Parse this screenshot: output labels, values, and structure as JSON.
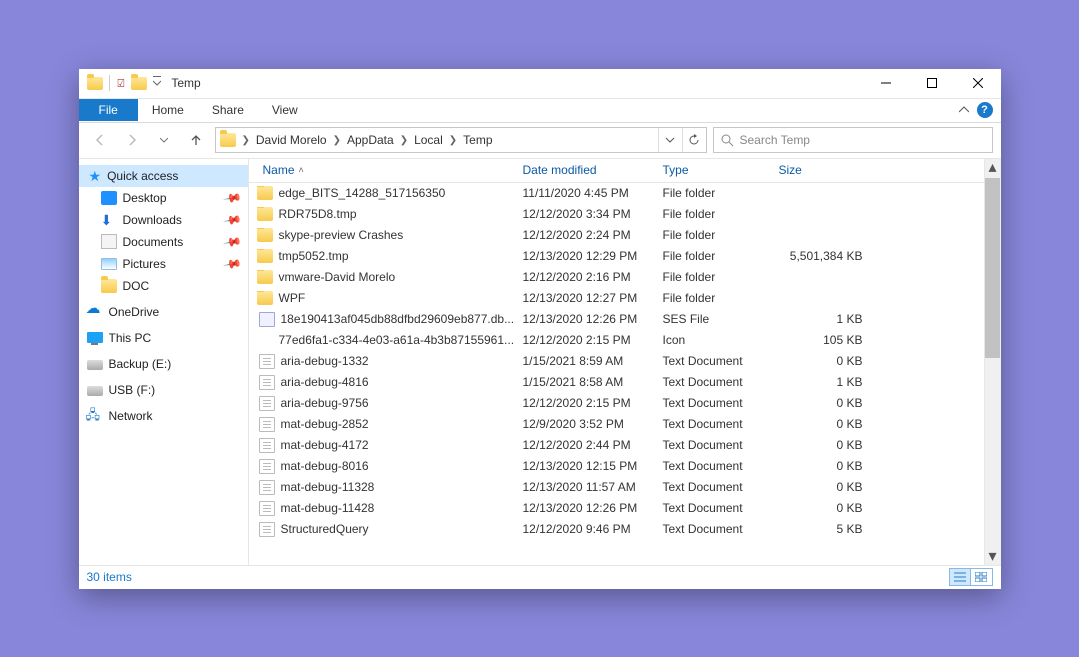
{
  "window": {
    "title": "Temp"
  },
  "ribbon": {
    "file": "File",
    "home": "Home",
    "share": "Share",
    "view": "View"
  },
  "breadcrumb": [
    "David Morelo",
    "AppData",
    "Local",
    "Temp"
  ],
  "search": {
    "placeholder": "Search Temp"
  },
  "sidebar": {
    "quick_access": "Quick access",
    "pinned": [
      {
        "label": "Desktop",
        "icon": "desktop"
      },
      {
        "label": "Downloads",
        "icon": "downloads"
      },
      {
        "label": "Documents",
        "icon": "documents"
      },
      {
        "label": "Pictures",
        "icon": "pictures"
      }
    ],
    "doc": "DOC",
    "roots": [
      {
        "label": "OneDrive",
        "icon": "onedrive"
      },
      {
        "label": "This PC",
        "icon": "thispc"
      },
      {
        "label": "Backup (E:)",
        "icon": "drive"
      },
      {
        "label": "USB (F:)",
        "icon": "usb"
      },
      {
        "label": "Network",
        "icon": "network"
      }
    ]
  },
  "columns": {
    "name": "Name",
    "date": "Date modified",
    "type": "Type",
    "size": "Size"
  },
  "rows": [
    {
      "icon": "folder",
      "name": "edge_BITS_14288_517156350",
      "date": "11/11/2020 4:45 PM",
      "type": "File folder",
      "size": ""
    },
    {
      "icon": "folder",
      "name": "RDR75D8.tmp",
      "date": "12/12/2020 3:34 PM",
      "type": "File folder",
      "size": ""
    },
    {
      "icon": "folder",
      "name": "skype-preview Crashes",
      "date": "12/12/2020 2:24 PM",
      "type": "File folder",
      "size": ""
    },
    {
      "icon": "folder",
      "name": "tmp5052.tmp",
      "date": "12/13/2020 12:29 PM",
      "type": "File folder",
      "size": "5,501,384 KB"
    },
    {
      "icon": "folder",
      "name": "vmware-David Morelo",
      "date": "12/12/2020 2:16 PM",
      "type": "File folder",
      "size": ""
    },
    {
      "icon": "folder",
      "name": "WPF",
      "date": "12/13/2020 12:27 PM",
      "type": "File folder",
      "size": ""
    },
    {
      "icon": "db",
      "name": "18e190413af045db88dfbd29609eb877.db....",
      "date": "12/13/2020 12:26 PM",
      "type": "SES File",
      "size": "1 KB"
    },
    {
      "icon": "blank",
      "name": "77ed6fa1-c334-4e03-a61a-4b3b87155961....",
      "date": "12/12/2020 2:15 PM",
      "type": "Icon",
      "size": "105 KB"
    },
    {
      "icon": "txt",
      "name": "aria-debug-1332",
      "date": "1/15/2021 8:59 AM",
      "type": "Text Document",
      "size": "0 KB"
    },
    {
      "icon": "txt",
      "name": "aria-debug-4816",
      "date": "1/15/2021 8:58 AM",
      "type": "Text Document",
      "size": "1 KB"
    },
    {
      "icon": "txt",
      "name": "aria-debug-9756",
      "date": "12/12/2020 2:15 PM",
      "type": "Text Document",
      "size": "0 KB"
    },
    {
      "icon": "txt",
      "name": "mat-debug-2852",
      "date": "12/9/2020 3:52 PM",
      "type": "Text Document",
      "size": "0 KB"
    },
    {
      "icon": "txt",
      "name": "mat-debug-4172",
      "date": "12/12/2020 2:44 PM",
      "type": "Text Document",
      "size": "0 KB"
    },
    {
      "icon": "txt",
      "name": "mat-debug-8016",
      "date": "12/13/2020 12:15 PM",
      "type": "Text Document",
      "size": "0 KB"
    },
    {
      "icon": "txt",
      "name": "mat-debug-11328",
      "date": "12/13/2020 11:57 AM",
      "type": "Text Document",
      "size": "0 KB"
    },
    {
      "icon": "txt",
      "name": "mat-debug-11428",
      "date": "12/13/2020 12:26 PM",
      "type": "Text Document",
      "size": "0 KB"
    },
    {
      "icon": "txt",
      "name": "StructuredQuery",
      "date": "12/12/2020 9:46 PM",
      "type": "Text Document",
      "size": "5 KB"
    }
  ],
  "status": {
    "count": "30 items"
  }
}
